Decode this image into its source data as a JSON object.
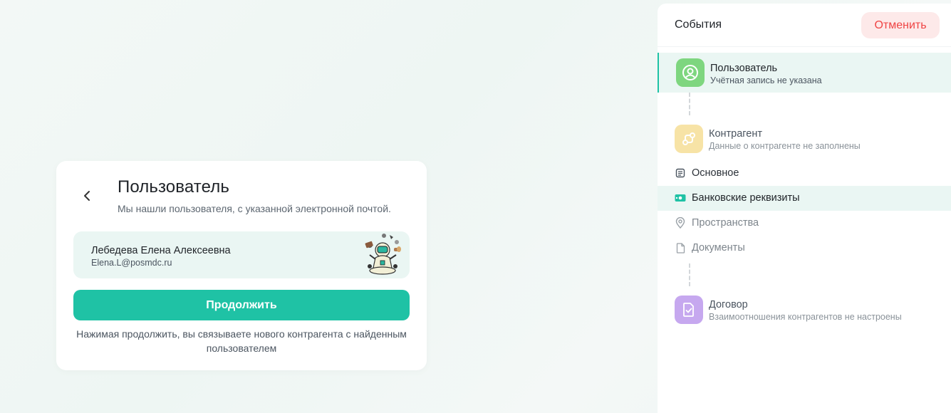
{
  "card": {
    "title": "Пользователь",
    "subtitle": "Мы нашли пользователя, с указанной электронной почтой.",
    "user_name": "Лебедева Елена Алексеевна",
    "user_email": "Elena.L@posmdc.ru",
    "continue_label": "Продолжить",
    "note": "Нажимая продолжить, вы связываете нового контрагента с найденным пользователем"
  },
  "panel": {
    "title": "События",
    "cancel_label": "Отменить",
    "steps": [
      {
        "title": "Пользователь",
        "desc": "Учётная запись не указана",
        "icon": "user-circle-icon",
        "color": "#7ed67f",
        "state": "active"
      },
      {
        "title": "Контрагент",
        "desc": "Данные о контрагенте не заполнены",
        "icon": "route-icon",
        "color": "#f7e3a6",
        "state": "pending"
      },
      {
        "title": "Договор",
        "desc": "Взаимоотношения контрагентов не настроены",
        "icon": "document-check-icon",
        "color": "#c6a8ef",
        "state": "pending"
      }
    ],
    "sub_items": [
      {
        "label": "Основное",
        "icon": "document-text-icon",
        "state": "default"
      },
      {
        "label": "Банковские реквизиты",
        "icon": "banknote-icon",
        "state": "active"
      },
      {
        "label": "Пространства",
        "icon": "location-pin-icon",
        "state": "disabled"
      },
      {
        "label": "Документы",
        "icon": "file-icon",
        "state": "disabled"
      }
    ]
  },
  "colors": {
    "accent": "#1fc2a5",
    "danger": "#ef4444",
    "danger_bg": "#fde9e9",
    "highlight_bg": "#eaf6f3"
  }
}
